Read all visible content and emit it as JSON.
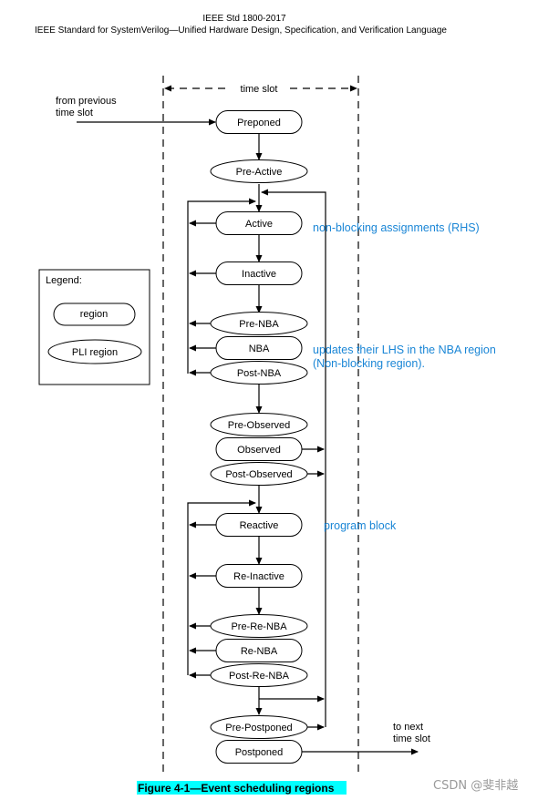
{
  "header": {
    "std": "IEEE Std 1800-2017",
    "title": "IEEE Standard for SystemVerilog—Unified Hardware Design, Specification, and Verification Language"
  },
  "time_slot_label": "time slot",
  "from_label": [
    "from previous",
    "time slot"
  ],
  "to_label": [
    "to next",
    "time slot"
  ],
  "legend": {
    "title": "Legend:",
    "region": "region",
    "pli_region": "PLI region"
  },
  "regions": [
    {
      "id": "preponed",
      "label": "Preponed",
      "type": "region"
    },
    {
      "id": "pre-active",
      "label": "Pre-Active",
      "type": "pli"
    },
    {
      "id": "active",
      "label": "Active",
      "type": "region"
    },
    {
      "id": "inactive",
      "label": "Inactive",
      "type": "region"
    },
    {
      "id": "pre-nba",
      "label": "Pre-NBA",
      "type": "pli"
    },
    {
      "id": "nba",
      "label": "NBA",
      "type": "region"
    },
    {
      "id": "post-nba",
      "label": "Post-NBA",
      "type": "pli"
    },
    {
      "id": "pre-observed",
      "label": "Pre-Observed",
      "type": "pli"
    },
    {
      "id": "observed",
      "label": "Observed",
      "type": "region"
    },
    {
      "id": "post-observed",
      "label": "Post-Observed",
      "type": "pli"
    },
    {
      "id": "reactive",
      "label": "Reactive",
      "type": "region"
    },
    {
      "id": "re-inactive",
      "label": "Re-Inactive",
      "type": "region"
    },
    {
      "id": "pre-re-nba",
      "label": "Pre-Re-NBA",
      "type": "pli"
    },
    {
      "id": "re-nba",
      "label": "Re-NBA",
      "type": "region"
    },
    {
      "id": "post-re-nba",
      "label": "Post-Re-NBA",
      "type": "pli"
    },
    {
      "id": "pre-postponed",
      "label": "Pre-Postponed",
      "type": "pli"
    },
    {
      "id": "postponed",
      "label": "Postponed",
      "type": "region"
    }
  ],
  "annotations": {
    "rhs": "non-blocking assignments (RHS)",
    "lhs_1": "updates their LHS in the NBA region",
    "lhs_2": "(Non-blocking region).",
    "program": "program block"
  },
  "caption": "Figure 4-1—Event scheduling regions",
  "caption_highlight": "#00ffff",
  "annotation_color": "#1a86d6",
  "watermark": "CSDN @斐非越"
}
